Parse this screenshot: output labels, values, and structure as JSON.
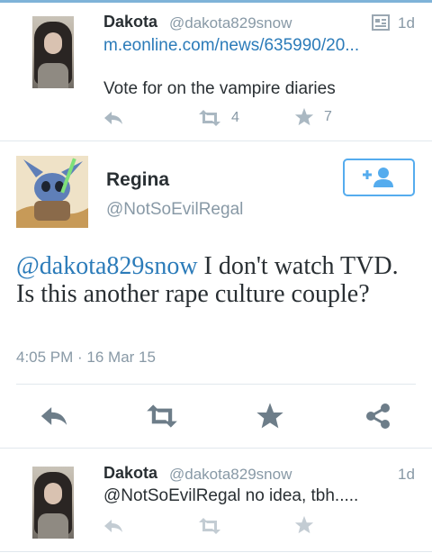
{
  "tweet1": {
    "name": "Dakota",
    "handle": "@dakota829snow",
    "time": "1d",
    "link": "m.eonline.com/news/635990/20...",
    "text": "Vote for on the vampire diaries",
    "retweets": "4",
    "favorites": "7"
  },
  "main": {
    "name": "Regina",
    "handle": "@NotSoEvilRegal",
    "mention": "@dakota829snow",
    "text": " I don't watch TVD. Is this another rape culture couple?",
    "timestamp": "4:05 PM · 16 Mar 15"
  },
  "tweet3": {
    "name": "Dakota",
    "handle": "@dakota829snow",
    "time": "1d",
    "text": "@NotSoEvilRegal no idea, tbh....."
  },
  "colors": {
    "link": "#2b7bb9",
    "follow_border": "#55acee",
    "muted": "#8899a6"
  }
}
